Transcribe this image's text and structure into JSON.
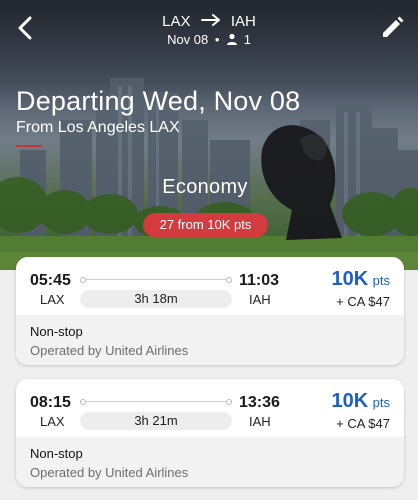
{
  "header": {
    "origin": "LAX",
    "destination": "IAH",
    "date": "Nov 08",
    "passengers": "1",
    "title": "Departing Wed, Nov 08",
    "subtitle": "From Los Angeles LAX",
    "cabin": "Economy",
    "results_pill": "27 from 10K pts"
  },
  "colors": {
    "accent_red": "#d33b3f",
    "points_blue": "#1e5fc4"
  },
  "icons": {
    "back": "chevron-left-icon",
    "edit": "pencil-icon",
    "passenger": "person-icon",
    "route_arrow": "arrow-right-icon"
  },
  "flights": [
    {
      "depart_time": "05:45",
      "depart_airport": "LAX",
      "arrive_time": "11:03",
      "arrive_airport": "IAH",
      "duration": "3h 18m",
      "points": "10K",
      "points_unit": "pts",
      "fee": "+ CA $47",
      "stops": "Non-stop",
      "operator": "Operated by United Airlines"
    },
    {
      "depart_time": "08:15",
      "depart_airport": "LAX",
      "arrive_time": "13:36",
      "arrive_airport": "IAH",
      "duration": "3h 21m",
      "points": "10K",
      "points_unit": "pts",
      "fee": "+ CA $47",
      "stops": "Non-stop",
      "operator": "Operated by United Airlines"
    }
  ]
}
